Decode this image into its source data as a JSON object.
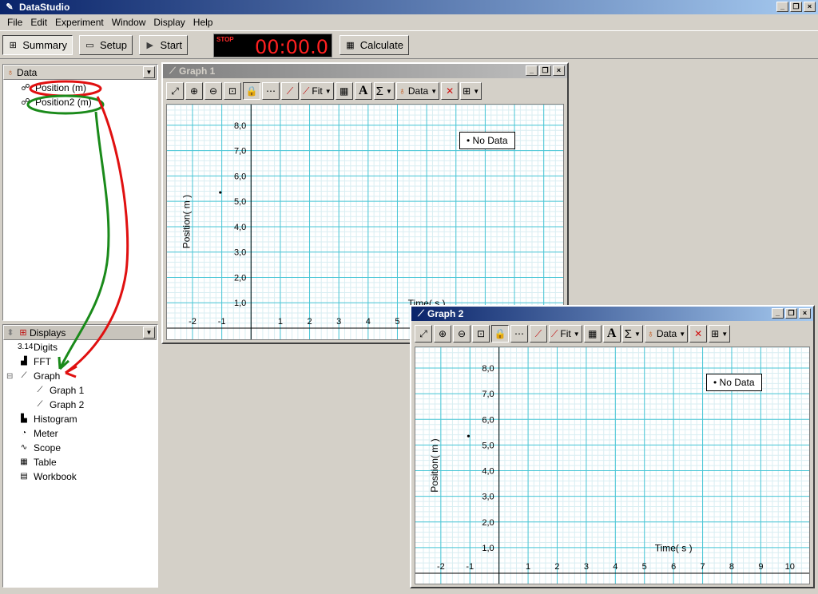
{
  "app": {
    "title": "DataStudio"
  },
  "window_buttons": [
    "_",
    "❐",
    "×"
  ],
  "menu": [
    "File",
    "Edit",
    "Experiment",
    "Window",
    "Display",
    "Help"
  ],
  "toolbar": {
    "summary": "Summary",
    "setup": "Setup",
    "start": "Start",
    "stop_label": "STOP",
    "timer": "00:00.0",
    "calculate": "Calculate"
  },
  "data_panel": {
    "title": "Data",
    "items": [
      {
        "label": "Position (m)"
      },
      {
        "label": "Position2 (m)"
      }
    ]
  },
  "displays_panel": {
    "title": "Displays",
    "items": [
      {
        "label": "Digits",
        "icon": "digits-icon",
        "glyph": "3.14",
        "level": 0
      },
      {
        "label": "FFT",
        "icon": "fft-icon",
        "glyph": "▟",
        "level": 0
      },
      {
        "label": "Graph",
        "icon": "graph-icon",
        "glyph": "⟋",
        "level": 0,
        "expanded": true
      },
      {
        "label": "Graph 1",
        "icon": "graph-icon",
        "glyph": "⟋",
        "level": 1
      },
      {
        "label": "Graph 2",
        "icon": "graph-icon",
        "glyph": "⟋",
        "level": 1
      },
      {
        "label": "Histogram",
        "icon": "histogram-icon",
        "glyph": "▙",
        "level": 0
      },
      {
        "label": "Meter",
        "icon": "meter-icon",
        "glyph": "◔",
        "level": 0
      },
      {
        "label": "Scope",
        "icon": "scope-icon",
        "glyph": "∿",
        "level": 0
      },
      {
        "label": "Table",
        "icon": "table-icon",
        "glyph": "▦",
        "level": 0
      },
      {
        "label": "Workbook",
        "icon": "workbook-icon",
        "glyph": "▤",
        "level": 0
      }
    ]
  },
  "graph_toolbar": {
    "fit": "Fit",
    "data": "Data",
    "sigma": "Σ",
    "text_tool": "A"
  },
  "graph1": {
    "title": "Graph 1",
    "legend": "No Data",
    "ylabel": "Position( m )",
    "xlabel": "Time( s )"
  },
  "graph2": {
    "title": "Graph 2",
    "legend": "No Data",
    "ylabel": "Position( m )",
    "xlabel": "Time( s )"
  },
  "chart_data": [
    {
      "type": "line",
      "title": "",
      "xlabel": "Time( s )",
      "ylabel": "Position( m )",
      "xlim": [
        -2.6,
        10.5
      ],
      "ylim": [
        0,
        8.5
      ],
      "x_ticks": [
        -2,
        -1,
        1,
        2,
        3,
        4,
        5,
        6,
        7,
        8,
        9,
        10
      ],
      "y_ticks": [
        "1,0",
        "2,0",
        "3,0",
        "4,0",
        "5,0",
        "6,0",
        "7,0",
        "8,0"
      ],
      "series": [],
      "legend": "No Data",
      "legend_position": "top-right",
      "grid": true
    },
    {
      "type": "line",
      "title": "",
      "xlabel": "Time( s )",
      "ylabel": "Position( m )",
      "xlim": [
        -2.6,
        10.5
      ],
      "ylim": [
        0,
        8.5
      ],
      "x_ticks": [
        -2,
        -1,
        1,
        2,
        3,
        4,
        5,
        6,
        7,
        8,
        9,
        10
      ],
      "y_ticks": [
        "1,0",
        "2,0",
        "3,0",
        "4,0",
        "5,0",
        "6,0",
        "7,0",
        "8,0"
      ],
      "series": [],
      "legend": "No Data",
      "legend_position": "top-right",
      "grid": true
    }
  ],
  "colors": {
    "title_active": "#0a246a",
    "grid_major": "#49c6d6",
    "grid_minor": "#d9eef2",
    "annot_red": "#e01010",
    "annot_green": "#1a8a1a",
    "timer_red": "#ff2020"
  }
}
